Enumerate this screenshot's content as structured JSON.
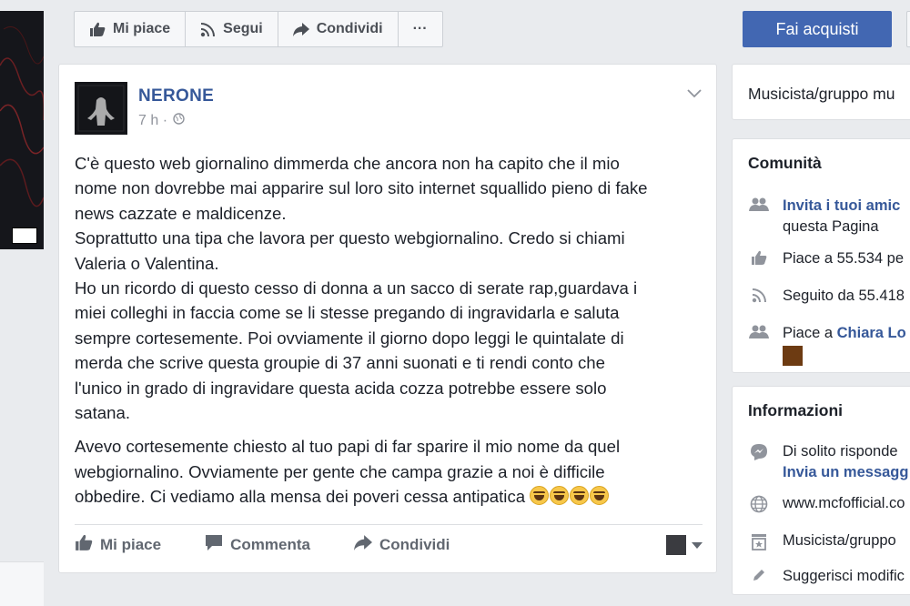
{
  "actionbar": {
    "like": "Mi piace",
    "follow": "Segui",
    "share": "Condividi",
    "more": "···"
  },
  "buy_button": "Fai acquisti",
  "post": {
    "author": "NERONE",
    "time": "7 h ·",
    "paragraphs": [
      "C'è questo web giornalino dimmerda che ancora non ha capito che il mio\nnome non dovrebbe mai apparire sul loro sito internet squallido pieno di fake\nnews cazzate e maldicenze.\nSoprattutto una tipa che lavora per questo webgiornalino. Credo si chiami\nValeria o Valentina.\nHo un ricordo di questo cesso di donna a un sacco di serate rap,guardava i\nmiei colleghi in faccia come se li stesse pregando di ingravidarla e saluta\nsempre cortesemente. Poi ovviamente il giorno dopo leggi le quintalate di\nmerda che scrive questa groupie di 37 anni suonati e ti rendi conto che\nl'unico in grado di ingravidare questa acida cozza potrebbe essere solo\nsatana.",
      "Avevo cortesemente chiesto al tuo papi di far sparire il mio nome da quel\nwebgiornalino. Ovviamente per gente che campa grazie a noi è difficile\nobbedire. Ci vediamo alla mensa dei poveri cessa antipatica "
    ],
    "emoji_count": 4,
    "actions": {
      "like": "Mi piace",
      "comment": "Commenta",
      "share": "Condividi"
    }
  },
  "right": {
    "category": "Musicista/gruppo mu",
    "community": {
      "title": "Comunità",
      "invite_link": "Invita i tuoi amic",
      "invite_rest": "questa Pagina",
      "likes": "Piace a 55.534 pe",
      "follows": "Seguito da 55.418",
      "liked_by_prefix": "Piace a ",
      "liked_by_name": "Chiara Lo"
    },
    "info": {
      "title": "Informazioni",
      "responds": "Di solito risponde",
      "message_link": "Invia un messagg",
      "website": "www.mcfofficial.co",
      "category": "Musicista/gruppo",
      "suggest": "Suggerisci modific"
    }
  }
}
